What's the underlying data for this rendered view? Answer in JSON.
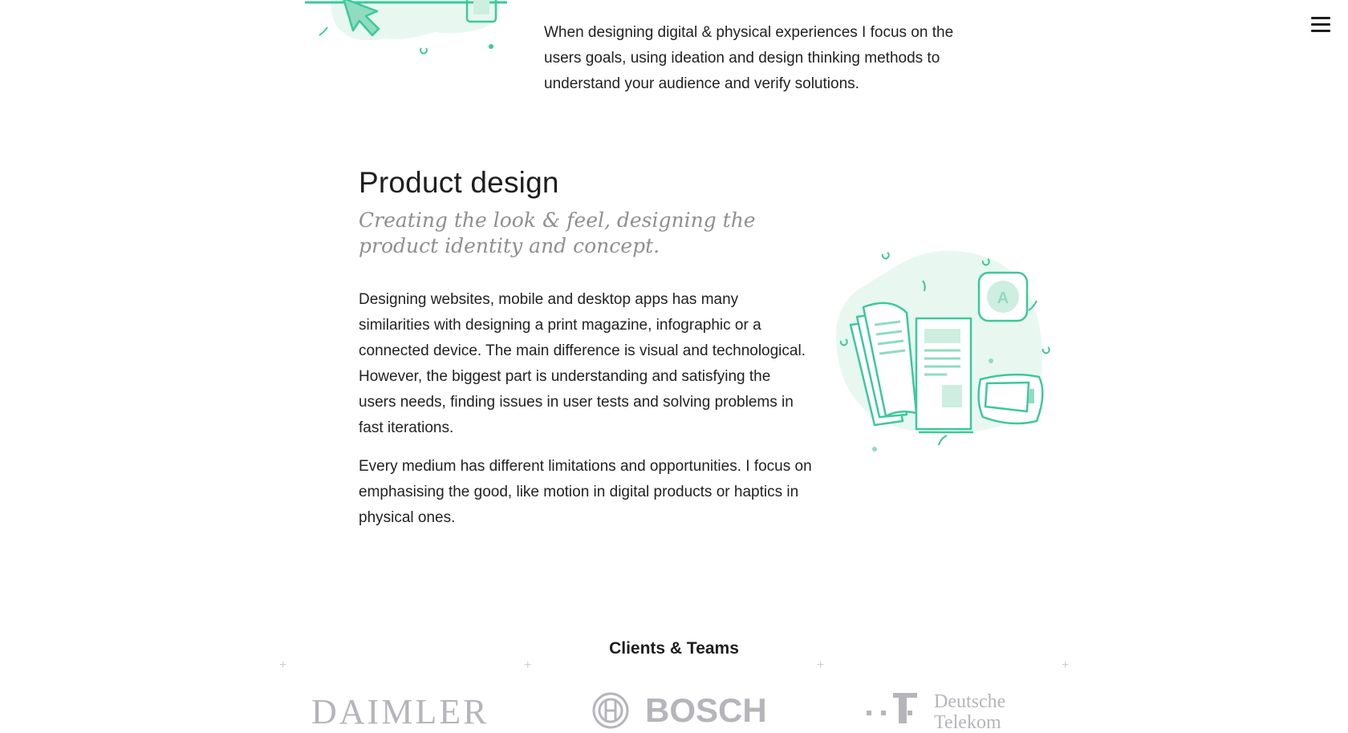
{
  "header": {
    "menu_icon": "hamburger-menu-icon"
  },
  "ux_section": {
    "text": "When designing digital & physical experiences I focus on the users goals, using ideation and design thinking methods to understand your audience and verify solutions."
  },
  "product_section": {
    "title": "Product design",
    "subtitle": "Creating the look & feel, designing the product identity and concept.",
    "paragraph1": "Designing websites, mobile and desktop apps has many similarities with designing a print magazine, infographic or a connected device. The main difference is visual and technological. However, the biggest part is understanding and satisfying the users needs, finding issues in user tests and solving problems in fast iterations.",
    "paragraph2": "Every medium has different limitations and opportunities. I focus on emphasising the good, like motion in digital products or haptics in physical ones.",
    "illustration_letter": "A"
  },
  "clients": {
    "title": "Clients & Teams",
    "logos": [
      "DAIMLER",
      "BOSCH",
      "Deutsche Telekom"
    ]
  },
  "colors": {
    "accent": "#3cc89c",
    "accent_light": "#e8f8f1",
    "text": "#222222",
    "muted": "#8f8f8f",
    "logo_gray": "#b5b5bb"
  }
}
